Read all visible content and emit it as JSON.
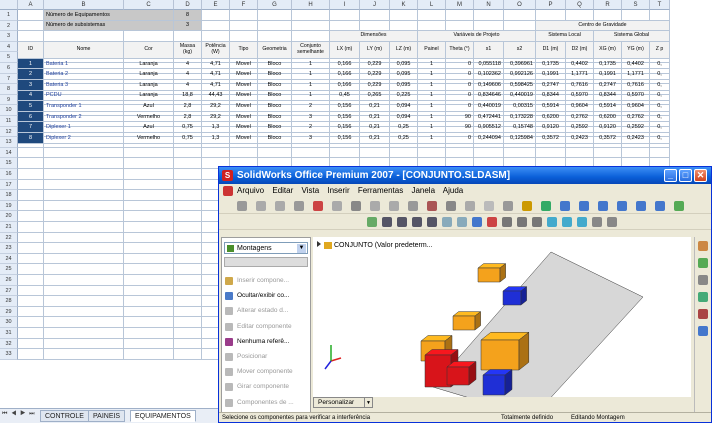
{
  "sheet": {
    "columns": [
      "A",
      "B",
      "C",
      "D",
      "E",
      "F",
      "G",
      "H",
      "I",
      "J",
      "K",
      "L",
      "M",
      "N",
      "O",
      "P",
      "Q",
      "R",
      "S",
      "T"
    ],
    "row_numbers": [
      "1",
      "2",
      "3",
      "4",
      "5",
      "6",
      "7",
      "8",
      "9",
      "10",
      "11",
      "12",
      "13",
      "14",
      "15",
      "16",
      "17",
      "18",
      "19",
      "20",
      "21",
      "22",
      "23",
      "24",
      "25",
      "26",
      "27",
      "28",
      "29",
      "30",
      "31",
      "32",
      "33"
    ],
    "info": {
      "equip_label": "Número de Equipamentos",
      "equip_value": "8",
      "subsys_label": "Número de subsistemas",
      "subsys_value": "3"
    },
    "group_headers": {
      "dimensoes": "Dimensões",
      "variaveis": "Variáveis de Projeto",
      "centro": "Centro de Gravidade",
      "local": "Sistema Local",
      "global": "Sistema Global"
    },
    "headers": [
      "ID",
      "Nome",
      "Cor",
      "Massa (kg)",
      "Potência (W)",
      "Tipo",
      "Geometria",
      "Conjunto semelhante",
      "LX (m)",
      "LY (m)",
      "LZ (m)",
      "Painel",
      "Theta (°)",
      "s1",
      "s2",
      "D1 (m)",
      "D2 (m)",
      "XG (m)",
      "YG (m)",
      "Z p"
    ],
    "rows": [
      [
        "1",
        "Bateria 1",
        "Laranja",
        "4",
        "4,71",
        "Movel",
        "Bloco",
        "1",
        "0,166",
        "0,229",
        "0,095",
        "1",
        "0",
        "0,055118",
        "0,396961",
        "0,1735",
        "0,4402",
        "0,1735",
        "0,4402",
        "0,"
      ],
      [
        "2",
        "Bateria 2",
        "Laranja",
        "4",
        "4,71",
        "Movel",
        "Bloco",
        "1",
        "0,166",
        "0,229",
        "0,095",
        "1",
        "0",
        "0,102362",
        "0,992126",
        "0,1991",
        "1,1771",
        "0,1991",
        "1,1771",
        "0,"
      ],
      [
        "3",
        "Bateria 3",
        "Laranja",
        "4",
        "4,71",
        "Movel",
        "Bloco",
        "1",
        "0,166",
        "0,229",
        "0,095",
        "1",
        "0",
        "0,149606",
        "0,598425",
        "0,2747",
        "0,7616",
        "0,2747",
        "0,7616",
        "0,"
      ],
      [
        "4",
        "PCDU",
        "Laranja",
        "18,8",
        "44,43",
        "Movel",
        "Bloco",
        "1",
        "0,45",
        "0,265",
        "0,225",
        "1",
        "0",
        "0,834646",
        "0,440019",
        "0,8344",
        "0,5970",
        "0,8344",
        "0,5970",
        "0,"
      ],
      [
        "5",
        "Transponder 1",
        "Azul",
        "2,8",
        "29,2",
        "Movel",
        "Bloco",
        "2",
        "0,156",
        "0,21",
        "0,094",
        "1",
        "0",
        "0,440019",
        "0,00315",
        "0,5914",
        "0,9604",
        "0,5914",
        "0,9604",
        "0,"
      ],
      [
        "6",
        "Transponder 2",
        "Vermelho",
        "2,8",
        "29,2",
        "Movel",
        "Bloco",
        "3",
        "0,156",
        "0,21",
        "0,094",
        "1",
        "90",
        "0,472441",
        "0,173228",
        "0,6200",
        "0,2762",
        "0,6200",
        "0,2762",
        "0,"
      ],
      [
        "7",
        "Diplexer 1",
        "Azul",
        "0,75",
        "1,3",
        "Movel",
        "Bloco",
        "2",
        "0,156",
        "0,21",
        "0,25",
        "1",
        "90",
        "0,905512",
        "0,15748",
        "0,9120",
        "0,2592",
        "0,9120",
        "0,2592",
        "0,"
      ],
      [
        "8",
        "Diplexer 2",
        "Vermelho",
        "0,75",
        "1,3",
        "Movel",
        "Bloco",
        "3",
        "0,156",
        "0,21",
        "0,25",
        "1",
        "0",
        "0,244094",
        "0,125984",
        "0,3572",
        "0,2423",
        "0,3572",
        "0,2423",
        "0,"
      ]
    ],
    "tabs": {
      "nav": "⏮ ◀ ▶ ⏭",
      "controle": "CONTROLE",
      "paineis": "PAINEIS",
      "equipamentos": "EQUIPAMENTOS"
    }
  },
  "solidworks": {
    "title": "SolidWorks Office Premium 2007 - [CONJUNTO.SLDASM]",
    "logo": "S",
    "menu": [
      "Arquivo",
      "Editar",
      "Vista",
      "Inserir",
      "Ferramentas",
      "Janela",
      "Ajuda"
    ],
    "window_buttons": {
      "minimize": "_",
      "maximize": "□",
      "close": "✕"
    },
    "command_manager": "Montagens",
    "commands": [
      {
        "label": "Inserir compone...",
        "enabled": false
      },
      {
        "label": "Ocultar/exibir co...",
        "enabled": true
      },
      {
        "label": "Alterar estado d...",
        "enabled": false
      },
      {
        "label": "Editar componente",
        "enabled": false
      },
      {
        "label": "Nenhuma referê...",
        "enabled": true
      },
      {
        "label": "Posicionar",
        "enabled": false
      },
      {
        "label": "Mover componente",
        "enabled": false
      },
      {
        "label": "Girar componente",
        "enabled": false
      },
      {
        "label": "Componentes de ...",
        "enabled": false
      }
    ],
    "tree_root": "CONJUNTO  (Valor predeterm...",
    "customize": "Personalizar",
    "status": {
      "left": "Selecione os componentes para verificar a interferência",
      "mid": "Totalmente definido",
      "right": "Editando Montagem"
    },
    "colors": {
      "orange": "#f4a21c",
      "red": "#d8141a",
      "blue": "#1f2fd6",
      "plate": "#d7d7d7"
    }
  }
}
